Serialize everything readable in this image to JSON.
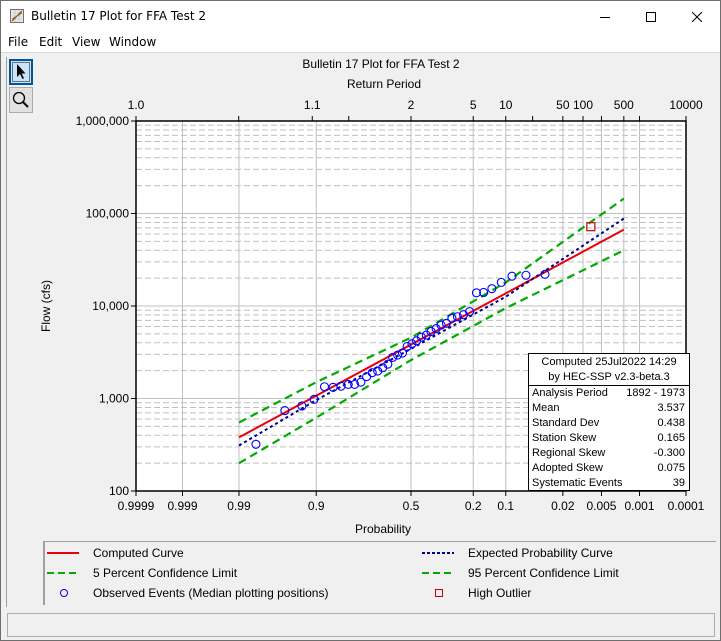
{
  "window": {
    "title": "Bulletin 17 Plot for FFA Test 2",
    "controls": {
      "minimize": "minimize-icon",
      "maximize": "maximize-icon",
      "close": "close-icon"
    }
  },
  "menu": [
    "File",
    "Edit",
    "View",
    "Window"
  ],
  "tools": [
    {
      "name": "select-arrow-icon",
      "active": true
    },
    {
      "name": "zoom-magnifier-icon",
      "active": false
    }
  ],
  "stats": {
    "header_line1": "Computed 25Jul2022 14:29",
    "header_line2": "by HEC-SSP v2.3-beta.3",
    "rows": [
      {
        "label": "Analysis Period",
        "value": "1892 - 1973"
      },
      {
        "label": "Mean",
        "value": "3.537"
      },
      {
        "label": "Standard Dev",
        "value": "0.438"
      },
      {
        "label": "Station Skew",
        "value": "0.165"
      },
      {
        "label": "Regional Skew",
        "value": "-0.300"
      },
      {
        "label": "Adopted Skew",
        "value": "0.075"
      },
      {
        "label": "Systematic Events",
        "value": "39"
      }
    ]
  },
  "legend": [
    {
      "label": "Computed Curve",
      "style": "solid",
      "color": "#e8000b"
    },
    {
      "label": "Expected Probability Curve",
      "style": "dotted",
      "color": "#00008b"
    },
    {
      "label": "5 Percent Confidence Limit",
      "style": "dashed",
      "color": "#00aa00"
    },
    {
      "label": "95 Percent Confidence Limit",
      "style": "dashed",
      "color": "#00aa00"
    },
    {
      "label": "Observed Events (Median plotting positions)",
      "style": "circle",
      "color": "#0000ff"
    },
    {
      "label": "High Outlier",
      "style": "square",
      "color": "#cc0000"
    }
  ],
  "chart_data": {
    "type": "scatter",
    "title": "Bulletin 17 Plot for FFA Test 2",
    "top_axis_title": "Return Period",
    "xlabel": "Probability",
    "ylabel": "Flow (cfs)",
    "x_scale": "normal-probability (exceedance)",
    "y_scale": "log",
    "ylim": [
      100,
      1000000
    ],
    "xlim": [
      0.9999,
      0.0001
    ],
    "grid": true,
    "x_ticks": [
      "0.9999",
      "0.999",
      "0.99",
      "0.9",
      "0.5",
      "0.2",
      "0.1",
      "0.02",
      "0.005",
      "0.001",
      "0.0001"
    ],
    "x_tick_values": [
      0.9999,
      0.999,
      0.99,
      0.9,
      0.5,
      0.2,
      0.1,
      0.02,
      0.005,
      0.001,
      0.0001
    ],
    "top_ticks": [
      "1.0",
      "1.1",
      "2",
      "5",
      "10",
      "50",
      "100",
      "500",
      "10000"
    ],
    "top_tick_values": [
      1.0001,
      1.1,
      2,
      5,
      10,
      50,
      100,
      500,
      10000
    ],
    "y_ticks": [
      "100",
      "1,000",
      "10,000",
      "100,000",
      "1,000,000"
    ],
    "y_tick_values": [
      100,
      1000,
      10000,
      100000,
      1000000
    ],
    "series": [
      {
        "name": "Computed Curve",
        "x": [
          0.99,
          0.002
        ],
        "y": [
          380,
          67000
        ]
      },
      {
        "name": "Expected Probability Curve",
        "x": [
          0.99,
          0.9,
          0.5,
          0.1,
          0.002
        ],
        "y": [
          310,
          960,
          3450,
          12600,
          88000
        ]
      },
      {
        "name": "5 Percent Confidence Limit",
        "x": [
          0.99,
          0.9,
          0.5,
          0.1,
          0.002
        ],
        "y": [
          550,
          1500,
          4550,
          18000,
          145000
        ]
      },
      {
        "name": "95 Percent Confidence Limit",
        "x": [
          0.99,
          0.9,
          0.5,
          0.1,
          0.002
        ],
        "y": [
          200,
          620,
          2600,
          9500,
          40000
        ]
      }
    ],
    "observed": {
      "name": "Observed Events (Median plotting positions)",
      "x": [
        0.982,
        0.956,
        0.93,
        0.905,
        0.879,
        0.854,
        0.828,
        0.802,
        0.777,
        0.751,
        0.726,
        0.7,
        0.674,
        0.649,
        0.623,
        0.598,
        0.572,
        0.546,
        0.521,
        0.495,
        0.47,
        0.444,
        0.418,
        0.393,
        0.367,
        0.342,
        0.316,
        0.29,
        0.265,
        0.239,
        0.214,
        0.188,
        0.163,
        0.137,
        0.111,
        0.086,
        0.06,
        0.035
      ],
      "y": [
        320,
        740,
        830,
        980,
        1340,
        1320,
        1360,
        1420,
        1420,
        1500,
        1720,
        1900,
        1980,
        2150,
        2350,
        2780,
        2950,
        3100,
        3650,
        3900,
        4200,
        4600,
        4850,
        5300,
        5700,
        6200,
        6500,
        7400,
        7650,
        8050,
        8700,
        13900,
        14000,
        15400,
        18000,
        21000,
        21500,
        22000
      ]
    },
    "high_outlier": {
      "name": "High Outlier",
      "x": [
        0.0075
      ],
      "y": [
        72000
      ]
    }
  }
}
